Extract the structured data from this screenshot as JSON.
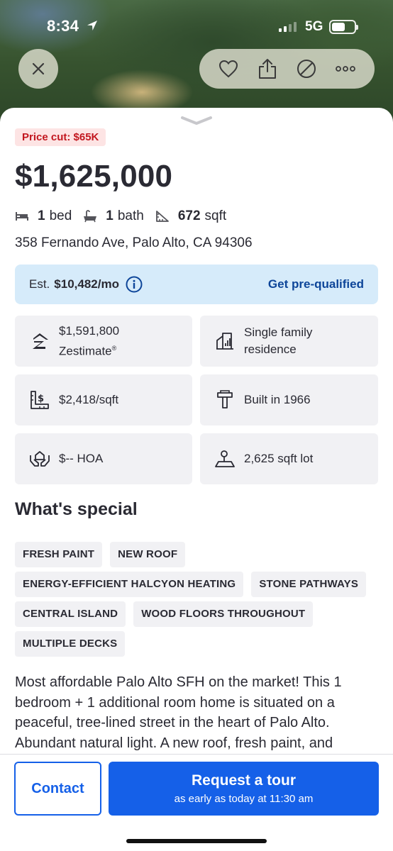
{
  "status_bar": {
    "time": "8:34",
    "network": "5G"
  },
  "header_actions": {
    "icons": [
      "close-icon",
      "heart-icon",
      "share-icon",
      "hide-icon",
      "more-icon"
    ]
  },
  "listing": {
    "price_cut": "Price cut: $65K",
    "price": "$1,625,000",
    "beds_count": "1",
    "beds_label": "bed",
    "baths_count": "1",
    "baths_label": "bath",
    "sqft_count": "672",
    "sqft_label": "sqft",
    "address": "358 Fernando Ave, Palo Alto, CA 94306"
  },
  "estimate": {
    "label": "Est.",
    "value": "$10,482/mo",
    "cta": "Get pre-qualified"
  },
  "tiles": {
    "zestimate_value": "$1,591,800",
    "zestimate_label": "Zestimate",
    "zestimate_mark": "®",
    "type_line1": "Single family",
    "type_line2": "residence",
    "price_per_sqft": "$2,418/sqft",
    "built": "Built in 1966",
    "hoa": "$-- HOA",
    "lot": "2,625 sqft lot"
  },
  "special": {
    "title": "What's special",
    "tags": [
      "FRESH PAINT",
      "NEW ROOF",
      "ENERGY-EFFICIENT HALCYON HEATING",
      "STONE PATHWAYS",
      "CENTRAL ISLAND",
      "WOOD FLOORS THROUGHOUT",
      "MULTIPLE DECKS"
    ]
  },
  "description": "Most affordable Palo Alto SFH on the market! This 1 bedroom + 1 additional room home is situated on a peaceful, tree-lined street in the heart of Palo Alto. Abundant natural light. A new roof, fresh paint, and",
  "footer": {
    "contact": "Contact",
    "tour_title": "Request a tour",
    "tour_subtitle": "as early as today at 11:30 am"
  },
  "colors": {
    "accent": "#1560e8",
    "price_cut_bg": "#fde4e4",
    "price_cut_text": "#c2171f",
    "estimate_bg": "#d6ebfa",
    "tile_bg": "#f1f1f4"
  }
}
